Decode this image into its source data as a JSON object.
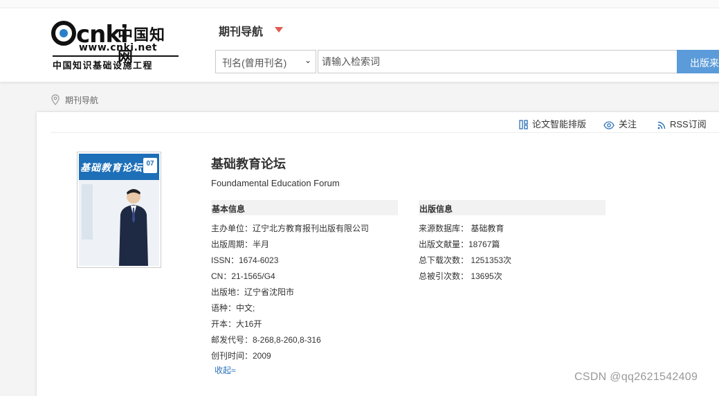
{
  "header": {
    "logo": {
      "brand": "cnki",
      "cn_name": "中国知网",
      "url": "www.cnki.net",
      "subtitle": "中国知识基础设施工程"
    },
    "nav_title": "期刊导航",
    "search": {
      "field_select": "刊名(曾用刊名)",
      "placeholder": "请输入检索词",
      "button_label": "出版来"
    }
  },
  "breadcrumb": {
    "label": "期刊导航"
  },
  "toolbar": {
    "layout_label": "论文智能排版",
    "follow_label": "关注",
    "rss_label": "RSS订阅"
  },
  "journal": {
    "cover": {
      "title": "基础教育论坛",
      "issue": "07"
    },
    "title": "基础教育论坛",
    "subtitle": "Foundamental Education Forum",
    "basic_info": {
      "heading": "基本信息",
      "fields": [
        "主办单位：辽宁北方教育报刊出版有限公司",
        "出版周期：半月",
        "ISSN：1674-6023",
        "CN：21-1565/G4",
        "出版地：辽宁省沈阳市",
        "语种：中文;",
        "开本：大16开",
        "邮发代号：8-268,8-260,8-316",
        "创刊时间：2009"
      ]
    },
    "publish_info": {
      "heading": "出版信息",
      "fields": [
        "来源数据库： 基础教育",
        "出版文献量：18767篇",
        "总下载次数： 1251353次",
        "总被引次数： 13695次"
      ]
    },
    "collapse_label": "收起≈"
  },
  "watermark": "CSDN @qq2621542409",
  "colors": {
    "accent": "#5b9bd9",
    "nav_arrow": "#e05a4f",
    "link": "#2a6fb8"
  }
}
